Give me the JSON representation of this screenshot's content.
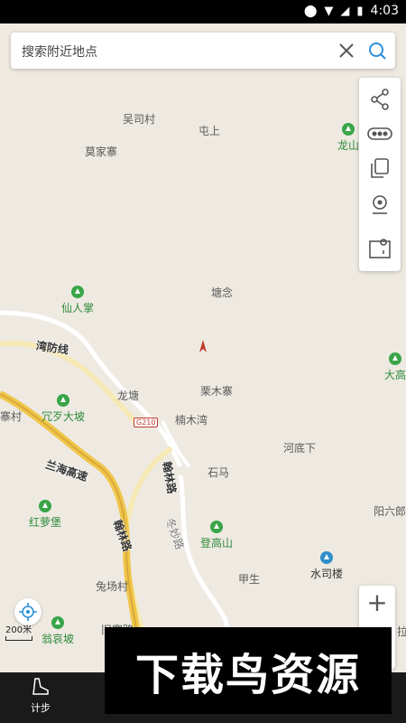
{
  "status": {
    "time": "4:03"
  },
  "search": {
    "placeholder": "搜索附近地点"
  },
  "places": {
    "wusi": "吴司村",
    "tunshang": "屯上",
    "mojia": "莫家寨",
    "tangnian": "塘念",
    "longtang": "龙塘",
    "limu": "栗木寨",
    "nanmu": "楠木湾",
    "hedixia": "河底下",
    "shima": "石马",
    "yangliu": "阳六郎",
    "jiasheng": "甲生",
    "tuchang": "兔场村",
    "jiuzhai": "旧寨路",
    "zhaicun": "寨村",
    "la": "拉"
  },
  "pois": {
    "longshan": "龙山",
    "xianren": "仙人掌",
    "rongdai": "冗歹大坡",
    "hongluo": "红萝堡",
    "dengao": "登高山",
    "wengai": "翁哀坡",
    "dagao": "大高",
    "shuisilou": "水司楼"
  },
  "roads": {
    "lanhai": "兰海高速",
    "hanlin": "翰林路",
    "hanlin2": "翰林路",
    "wanfang": "湾防线",
    "jiemiao": "冬妙路",
    "g210": "G210"
  },
  "scale": "200米",
  "bottom": {
    "step_label": "计步"
  },
  "watermark": "下载鸟资源",
  "colors": {
    "poi_green": "#3aa548",
    "road_yellow": "#f0c64a",
    "shield_red": "#c0392b"
  }
}
